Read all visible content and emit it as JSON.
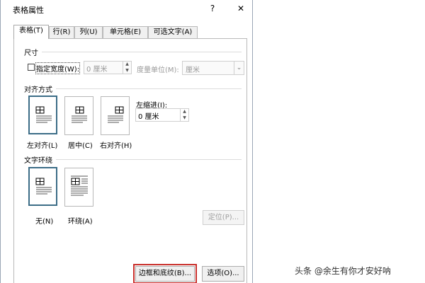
{
  "dialog": {
    "title": "表格属性",
    "help": "?",
    "close": "✕",
    "tabs": [
      {
        "label": "表格(T)"
      },
      {
        "label": "行(R)"
      },
      {
        "label": "列(U)"
      },
      {
        "label": "单元格(E)"
      },
      {
        "label": "可选文字(A)"
      }
    ],
    "size": {
      "group": "尺寸",
      "width_label": "指定宽度(W):",
      "width_value": "0 厘米",
      "unit_label": "度量单位(M):",
      "unit_value": "厘米"
    },
    "alignment": {
      "group": "对齐方式",
      "options": [
        {
          "label": "左对齐(L)",
          "selected": true
        },
        {
          "label": "居中(C)",
          "selected": false
        },
        {
          "label": "右对齐(H)",
          "selected": false
        }
      ],
      "indent_label": "左缩进(I):",
      "indent_value": "0 厘米"
    },
    "wrapping": {
      "group": "文字环绕",
      "options": [
        {
          "label": "无(N)",
          "selected": true
        },
        {
          "label": "环绕(A)",
          "selected": false
        }
      ],
      "position_button": "定位(P)..."
    },
    "buttons": {
      "borders": "边框和底纹(B)...",
      "options": "选项(O)..."
    }
  },
  "watermark": "头条 @余生有你才安好呐",
  "colors": {
    "selection_border": "#3c6d87",
    "highlight": "#c9302c"
  }
}
